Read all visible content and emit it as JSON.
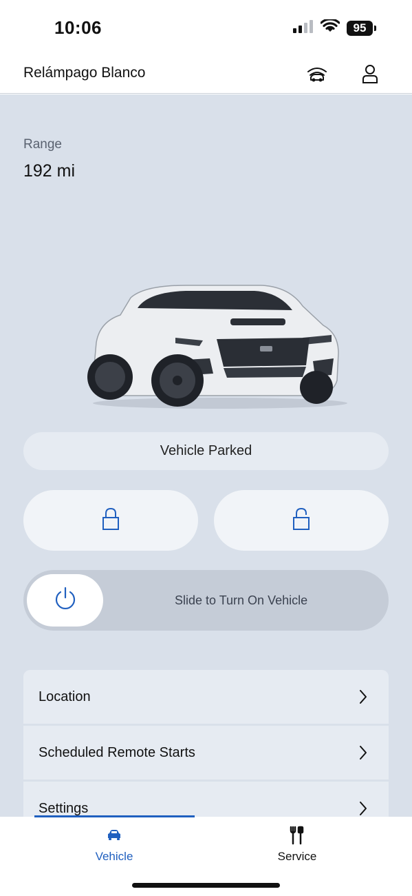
{
  "status_bar": {
    "time": "10:06",
    "battery": "95"
  },
  "header": {
    "vehicle_name": "Relámpago Blanco"
  },
  "range": {
    "label": "Range",
    "value": "192 mi"
  },
  "vehicle_status": "Vehicle Parked",
  "slider": {
    "label": "Slide to Turn On Vehicle"
  },
  "menu": {
    "items": [
      {
        "label": "Location"
      },
      {
        "label": "Scheduled Remote Starts"
      },
      {
        "label": "Settings"
      }
    ]
  },
  "nav": {
    "tabs": [
      {
        "label": "Vehicle",
        "active": true
      },
      {
        "label": "Service",
        "active": false
      }
    ]
  },
  "colors": {
    "accent": "#1f5fbf",
    "background": "#d9e0ea",
    "card": "#e6ebf2"
  }
}
